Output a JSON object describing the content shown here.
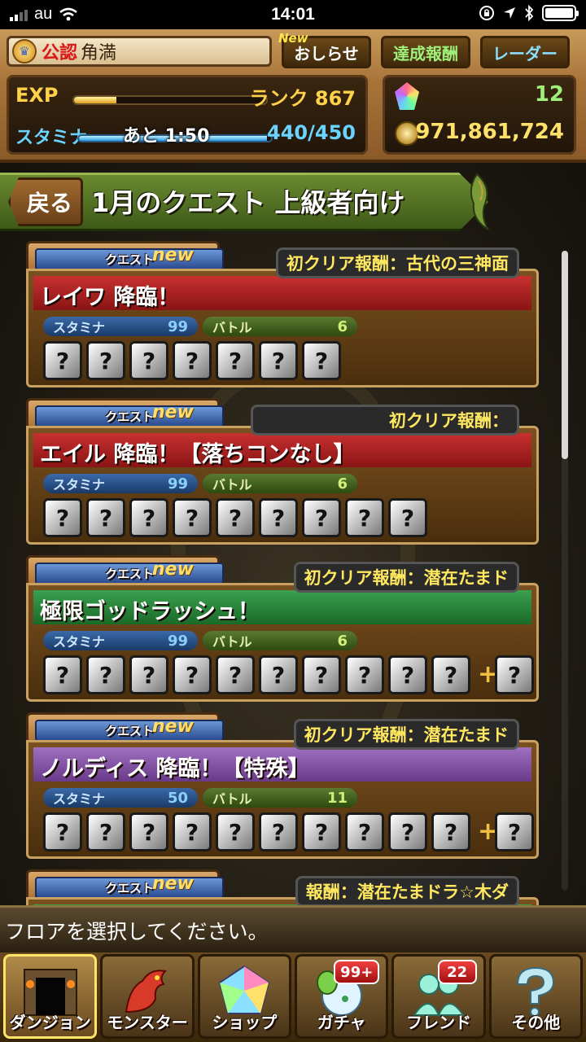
{
  "status_bar": {
    "carrier": "au",
    "time": "14:01"
  },
  "header": {
    "tag": "公認",
    "player_name": "角満",
    "new_badge": "New",
    "news_button": "おしらせ",
    "achievement_button": "達成報酬",
    "radar_button": "レーダー",
    "exp_label": "EXP",
    "exp_progress": 0.22,
    "rank": "ランク 867",
    "stamina_label": "スタミナ",
    "stamina_timer": "あと 1:50",
    "stamina_value": "440/450",
    "stamina_progress": 0.98,
    "magic_stones": "12",
    "coins": "971,861,724"
  },
  "page": {
    "back_button": "戻る",
    "title": "1月のクエスト 上級者向け"
  },
  "colors": {
    "band_red": "#a82020",
    "band_green": "#2a8a3c",
    "band_purple": "#8a58aa",
    "accent_yellow": "#ffe860"
  },
  "quests": [
    {
      "tab_label": "クエスト",
      "tab_new": "new",
      "name": "レイワ 降臨！",
      "reward": "初クリア報酬：古代の三神面",
      "stamina_label": "スタミナ",
      "stamina": "99",
      "battle_label": "バトル",
      "battles": "6",
      "unknown_symbol": "?",
      "more": false
    },
    {
      "tab_label": "クエスト",
      "tab_new": "new",
      "name": "エイル 降臨！【落ちコンなし】",
      "reward": "初クリア報酬：",
      "stamina_label": "スタミナ",
      "stamina": "99",
      "battle_label": "バトル",
      "battles": "6",
      "unknown_symbol": "?",
      "more": false
    },
    {
      "tab_label": "クエスト",
      "tab_new": "new",
      "name": "極限ゴッドラッシュ！",
      "reward": "初クリア報酬：潜在たまド",
      "stamina_label": "スタミナ",
      "stamina": "99",
      "battle_label": "バトル",
      "battles": "6",
      "unknown_symbol": "?",
      "more": true
    },
    {
      "tab_label": "クエスト",
      "tab_new": "new",
      "name": "ノルディス 降臨！【特殊】",
      "reward": "初クリア報酬：潜在たまド",
      "stamina_label": "スタミナ",
      "stamina": "50",
      "battle_label": "バトル",
      "battles": "11",
      "unknown_symbol": "?",
      "more": true
    },
    {
      "tab_label": "クエスト",
      "tab_new": "new",
      "name": "",
      "reward": "報酬：潜在たまドラ☆木ダ",
      "stamina_label": "",
      "stamina": "",
      "battle_label": "",
      "battles": "",
      "unknown_symbol": "?",
      "more": false
    }
  ],
  "prompt": "フロアを選択してください。",
  "tabs": [
    {
      "label": "ダンジョン",
      "icon": "dungeon-gate-icon",
      "badge": ""
    },
    {
      "label": "モンスター",
      "icon": "dragon-icon",
      "badge": ""
    },
    {
      "label": "ショップ",
      "icon": "rainbow-stone-icon",
      "badge": ""
    },
    {
      "label": "ガチャ",
      "icon": "egg-icon",
      "badge": "99+"
    },
    {
      "label": "フレンド",
      "icon": "friends-icon",
      "badge": "22"
    },
    {
      "label": "その他",
      "icon": "question-icon",
      "badge": ""
    }
  ]
}
